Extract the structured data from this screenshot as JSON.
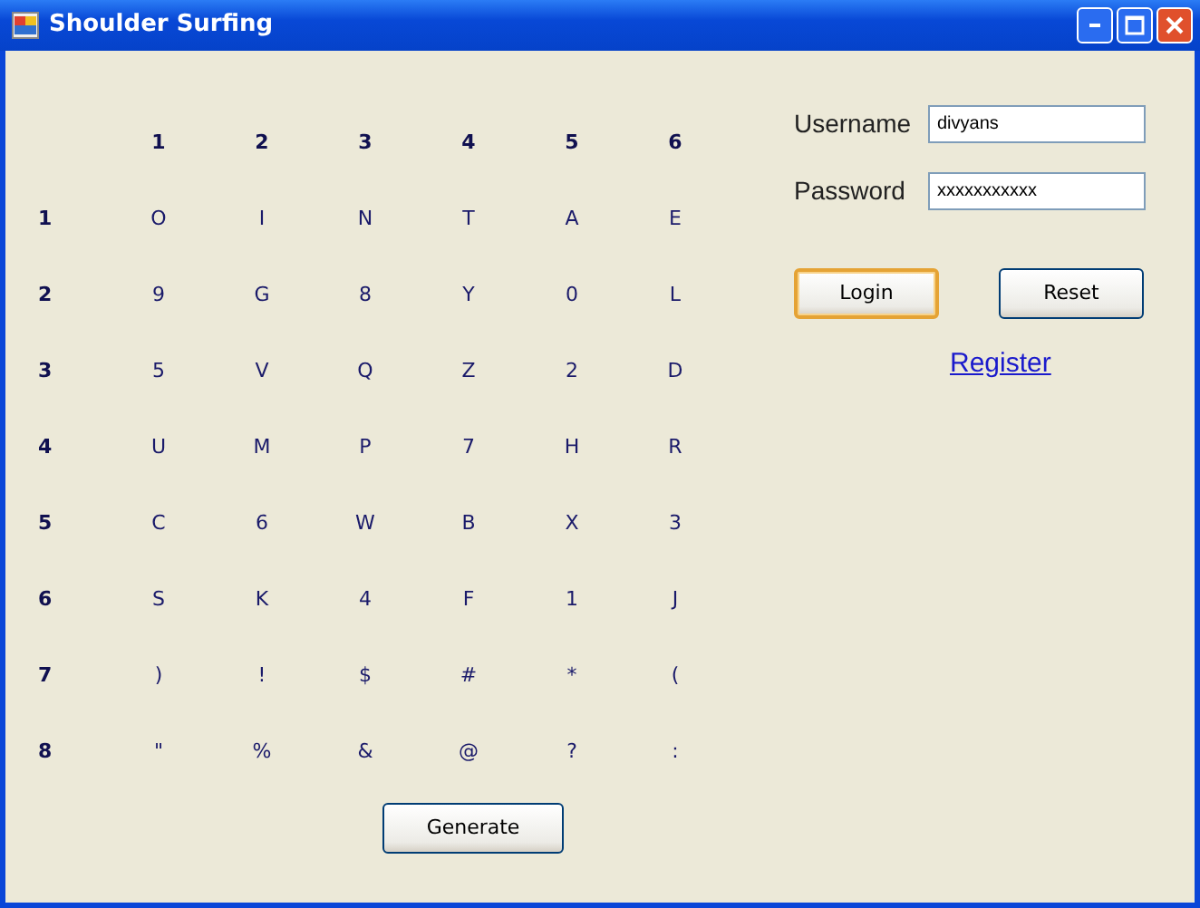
{
  "window": {
    "title": "Shoulder Surfing"
  },
  "grid": {
    "column_headers": [
      "1",
      "2",
      "3",
      "4",
      "5",
      "6"
    ],
    "rows": [
      {
        "label": "1",
        "cells": [
          "O",
          "I",
          "N",
          "T",
          "A",
          "E"
        ]
      },
      {
        "label": "2",
        "cells": [
          "9",
          "G",
          "8",
          "Y",
          "0",
          "L"
        ]
      },
      {
        "label": "3",
        "cells": [
          "5",
          "V",
          "Q",
          "Z",
          "2",
          "D"
        ]
      },
      {
        "label": "4",
        "cells": [
          "U",
          "M",
          "P",
          "7",
          "H",
          "R"
        ]
      },
      {
        "label": "5",
        "cells": [
          "C",
          "6",
          "W",
          "B",
          "X",
          "3"
        ]
      },
      {
        "label": "6",
        "cells": [
          "S",
          "K",
          "4",
          "F",
          "1",
          "J"
        ]
      },
      {
        "label": "7",
        "cells": [
          ")",
          "!",
          "$",
          "#",
          "*",
          "("
        ]
      },
      {
        "label": "8",
        "cells": [
          "\"",
          "%",
          "&",
          "@",
          "?",
          ":"
        ]
      }
    ]
  },
  "generate_button": {
    "label": "Generate"
  },
  "login": {
    "username_label": "Username",
    "username": "divyans",
    "password_label": "Password",
    "password": "xxxxxxxxxxx",
    "buttons": [
      {
        "label": "Login",
        "focused": true
      },
      {
        "label": "Reset",
        "focused": false
      }
    ],
    "register_link": "Register"
  }
}
